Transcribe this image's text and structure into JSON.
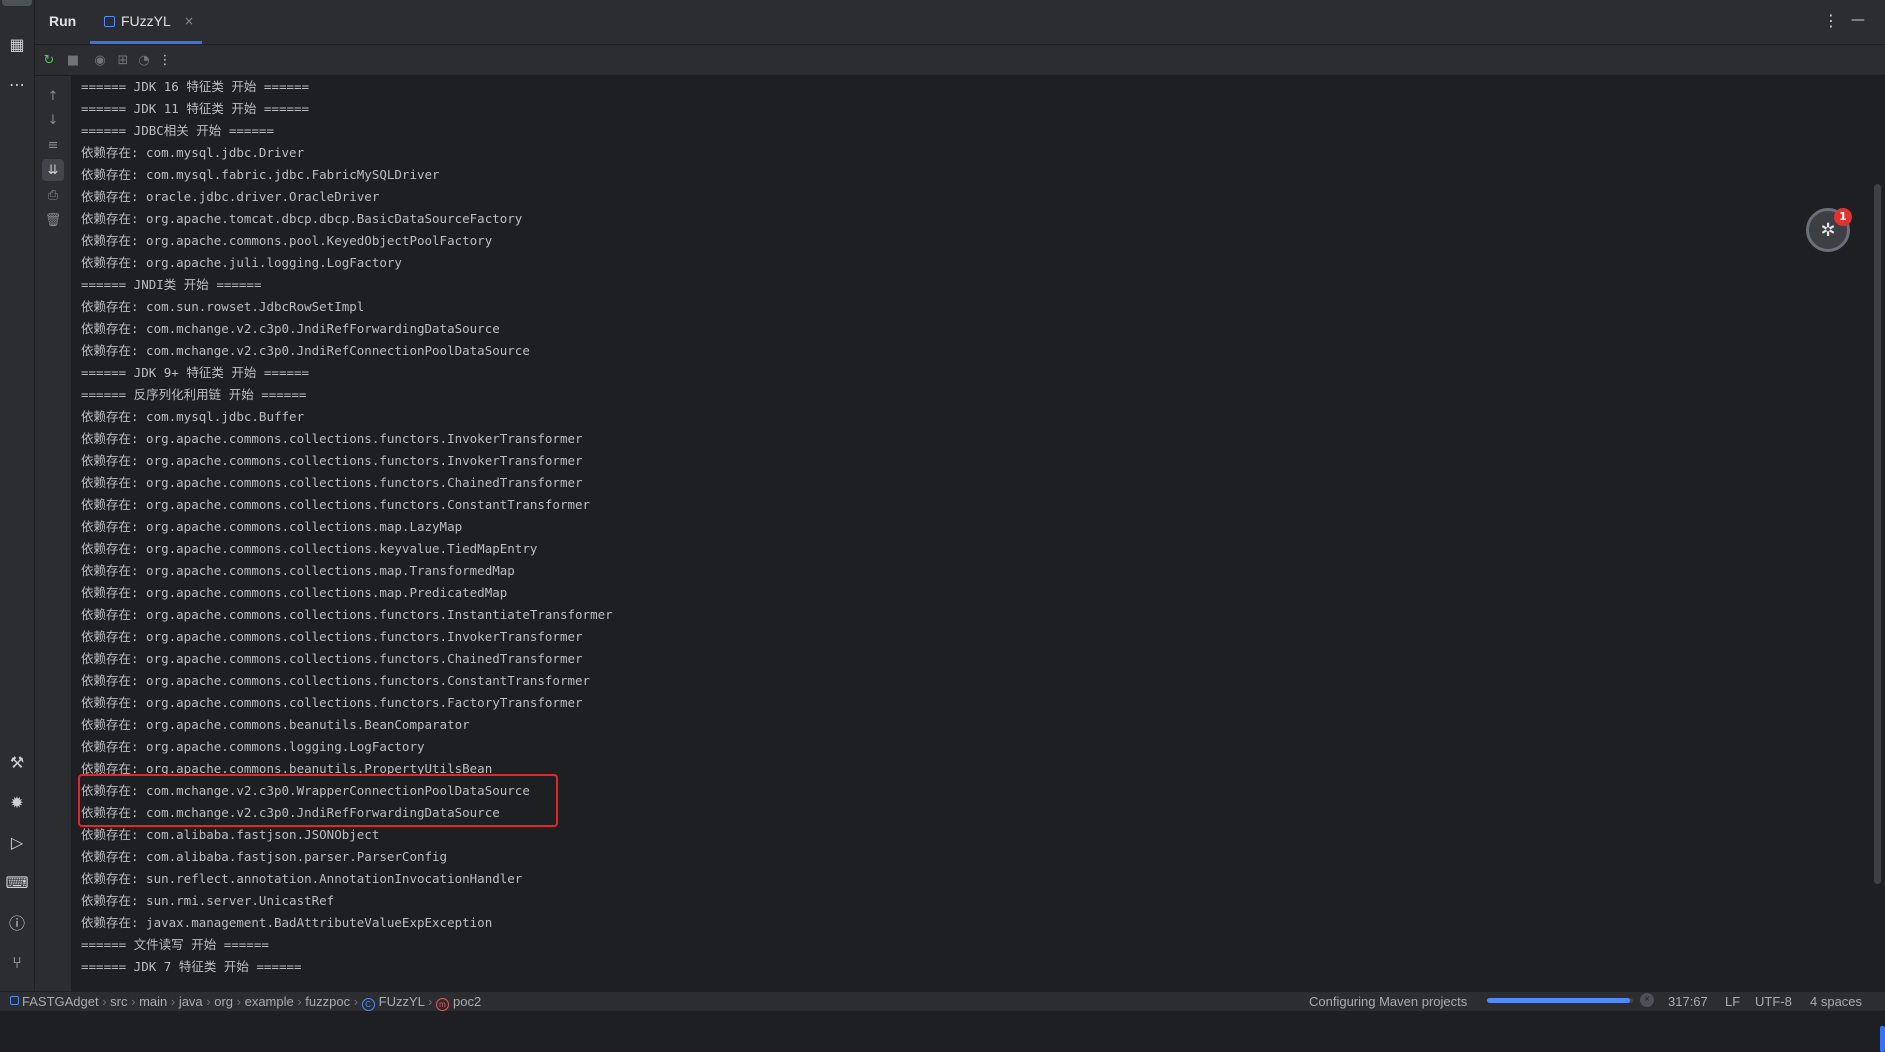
{
  "tabbar": {
    "run_label": "Run",
    "config_tab_label": "FUzzYL",
    "close_glyph": "×",
    "more_glyph": "⋮",
    "minimize_glyph": "—"
  },
  "console_lines": [
    "====== JDK 16 特征类 开始 ======",
    "====== JDK 11 特征类 开始 ======",
    "====== JDBC相关 开始 ======",
    "依赖存在: com.mysql.jdbc.Driver",
    "依赖存在: com.mysql.fabric.jdbc.FabricMySQLDriver",
    "依赖存在: oracle.jdbc.driver.OracleDriver",
    "依赖存在: org.apache.tomcat.dbcp.dbcp.BasicDataSourceFactory",
    "依赖存在: org.apache.commons.pool.KeyedObjectPoolFactory",
    "依赖存在: org.apache.juli.logging.LogFactory",
    "====== JNDI类 开始 ======",
    "依赖存在: com.sun.rowset.JdbcRowSetImpl",
    "依赖存在: com.mchange.v2.c3p0.JndiRefForwardingDataSource",
    "依赖存在: com.mchange.v2.c3p0.JndiRefConnectionPoolDataSource",
    "====== JDK 9+ 特征类 开始 ======",
    "====== 反序列化利用链 开始 ======",
    "依赖存在: com.mysql.jdbc.Buffer",
    "依赖存在: org.apache.commons.collections.functors.InvokerTransformer",
    "依赖存在: org.apache.commons.collections.functors.InvokerTransformer",
    "依赖存在: org.apache.commons.collections.functors.ChainedTransformer",
    "依赖存在: org.apache.commons.collections.functors.ConstantTransformer",
    "依赖存在: org.apache.commons.collections.map.LazyMap",
    "依赖存在: org.apache.commons.collections.keyvalue.TiedMapEntry",
    "依赖存在: org.apache.commons.collections.map.TransformedMap",
    "依赖存在: org.apache.commons.collections.map.PredicatedMap",
    "依赖存在: org.apache.commons.collections.functors.InstantiateTransformer",
    "依赖存在: org.apache.commons.collections.functors.InvokerTransformer",
    "依赖存在: org.apache.commons.collections.functors.ChainedTransformer",
    "依赖存在: org.apache.commons.collections.functors.ConstantTransformer",
    "依赖存在: org.apache.commons.collections.functors.FactoryTransformer",
    "依赖存在: org.apache.commons.beanutils.BeanComparator",
    "依赖存在: org.apache.commons.logging.LogFactory",
    "依赖存在: org.apache.commons.beanutils.PropertyUtilsBean",
    "依赖存在: com.mchange.v2.c3p0.WrapperConnectionPoolDataSource",
    "依赖存在: com.mchange.v2.c3p0.JndiRefForwardingDataSource",
    "依赖存在: com.alibaba.fastjson.JSONObject",
    "依赖存在: com.alibaba.fastjson.parser.ParserConfig",
    "依赖存在: sun.reflect.annotation.AnnotationInvocationHandler",
    "依赖存在: sun.rmi.server.UnicastRef",
    "依赖存在: javax.management.BadAttributeValueExpException",
    "====== 文件读写 开始 ======",
    "====== JDK 7 特征类 开始 ======"
  ],
  "notification_badge": "1",
  "statusbar": {
    "breadcrumb": [
      "FASTGAdget",
      "src",
      "main",
      "java",
      "org",
      "example",
      "fuzzpoc",
      "FUzzYL",
      "poc2"
    ],
    "class_icon_glyph": "C",
    "method_icon_glyph": "m",
    "task_label": "Configuring Maven projects",
    "progress": 0.98,
    "cancel_glyph": "×",
    "cursor_position": "317:67",
    "line_separator": "LF",
    "encoding": "UTF-8",
    "indent": "4 spaces"
  },
  "colors": {
    "accent": "#3574f0",
    "highlight_box": "#e0272a",
    "background": "#1e1f22",
    "panel": "#2b2d30"
  }
}
